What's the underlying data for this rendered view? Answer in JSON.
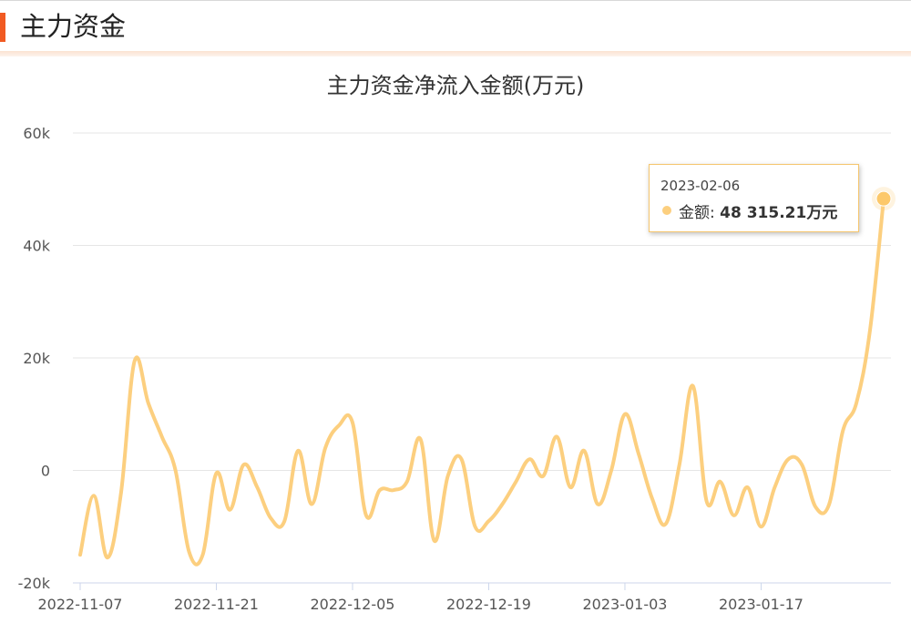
{
  "header": {
    "title": "主力资金"
  },
  "colors": {
    "accent": "#f15a22",
    "line": "#fccf7f",
    "grid": "#e6e6e6",
    "axis": "#ccd6eb"
  },
  "tooltip": {
    "date": "2023-02-06",
    "label": "金额: ",
    "value": "48 315.21万元"
  },
  "chart_data": {
    "type": "line",
    "title": "主力资金净流入金额(万元)",
    "xlabel": "",
    "ylabel": "",
    "ylim": [
      -20000,
      60000
    ],
    "y_ticks": [
      -20000,
      0,
      20000,
      40000,
      60000
    ],
    "y_tick_labels": [
      "-20k",
      "0",
      "20k",
      "40k",
      "60k"
    ],
    "x_tick_labels": [
      "2022-11-07",
      "2022-11-21",
      "2022-12-05",
      "2022-12-19",
      "2023-01-03",
      "2023-01-17"
    ],
    "x_tick_index": [
      0,
      10,
      20,
      30,
      40,
      50
    ],
    "grid": true,
    "series": [
      {
        "values": [
          -15000,
          -4500,
          -15500,
          -4000,
          19500,
          12000,
          6000,
          0,
          -14500,
          -15000,
          -500,
          -7000,
          1000,
          -3000,
          -8500,
          -9000,
          3500,
          -6000,
          4000,
          8000,
          8500,
          -8000,
          -3500,
          -3500,
          -2000,
          5500,
          -12500,
          -1000,
          2000,
          -10000,
          -9000,
          -6000,
          -2000,
          2000,
          -1000,
          6000,
          -3000,
          3500,
          -6000,
          0,
          10000,
          3000,
          -5000,
          -9500,
          1000,
          15000,
          -5500,
          -2000,
          -8000,
          -3000,
          -10000,
          -3000,
          2000,
          1000,
          -6500,
          -6000,
          7000,
          12000,
          25000,
          48315.21
        ]
      }
    ]
  }
}
